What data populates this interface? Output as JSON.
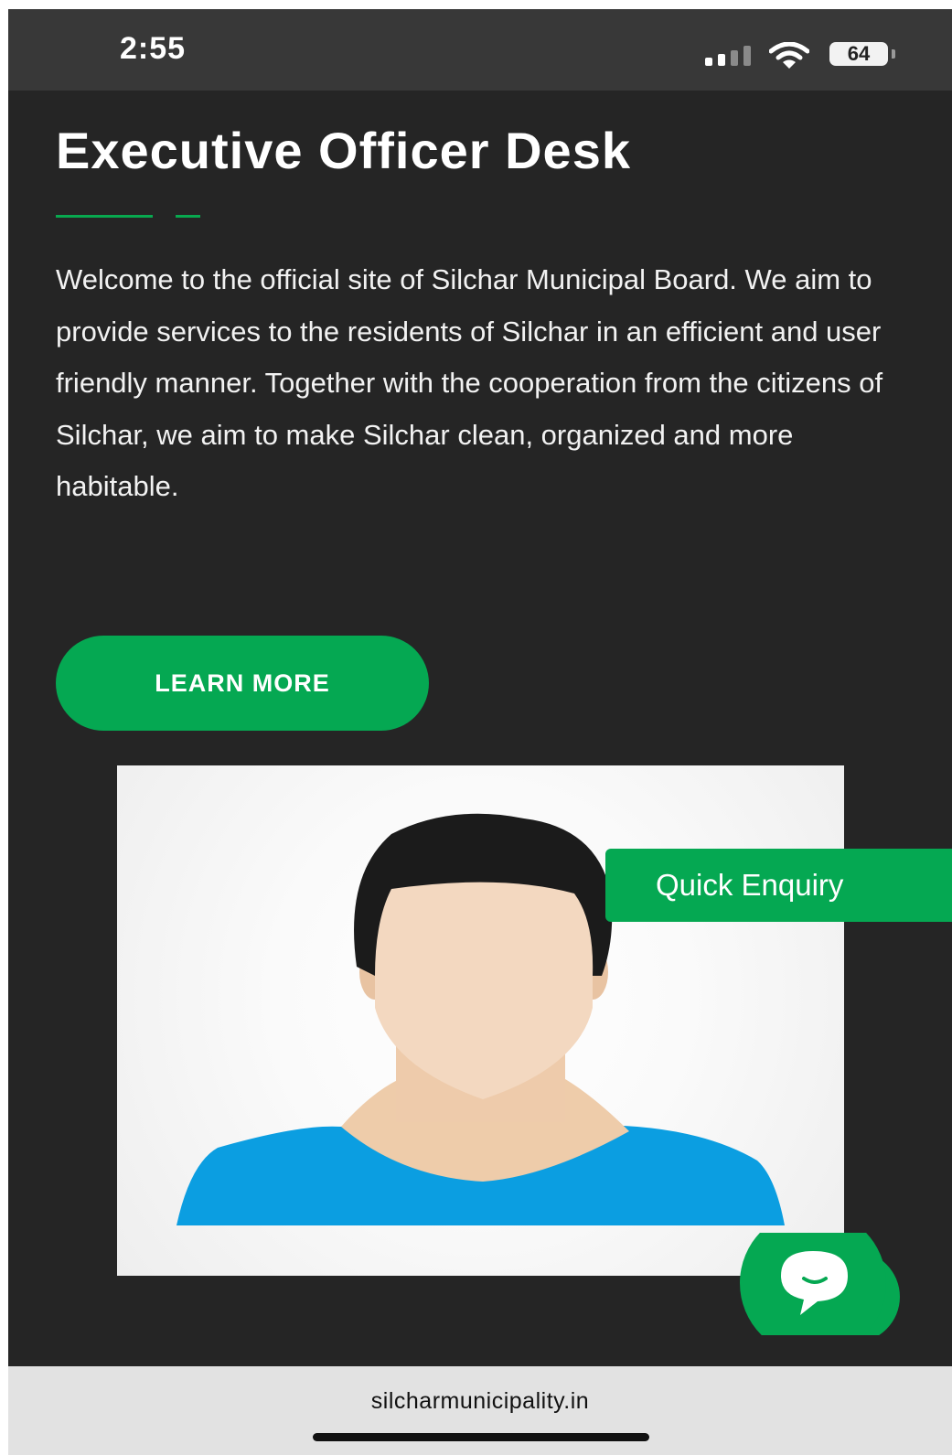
{
  "status_bar": {
    "time": "2:55",
    "battery": "64"
  },
  "page_title": "Executive Officer Desk",
  "intro_text": "Welcome to the official site of Silchar Municipal Board. We aim to provide services to the residents of Silchar in an efficient and user friendly manner. Together with the cooperation from the citizens of Silchar, we aim to make Silchar clean, organized and more habitable.",
  "learn_more_label": "LEARN MORE",
  "quick_enquiry_label": "Quick Enquiry",
  "browser": {
    "url": "silcharmunicipality.in"
  },
  "colors": {
    "accent": "#05a852",
    "background": "#252525",
    "status_bar": "#383838",
    "shirt": "#0b9ee1",
    "skin": "#f3d8c0",
    "hair": "#1b1b1b"
  },
  "icons": [
    "signal-icon",
    "wifi-icon",
    "battery-icon",
    "chat-icon"
  ]
}
